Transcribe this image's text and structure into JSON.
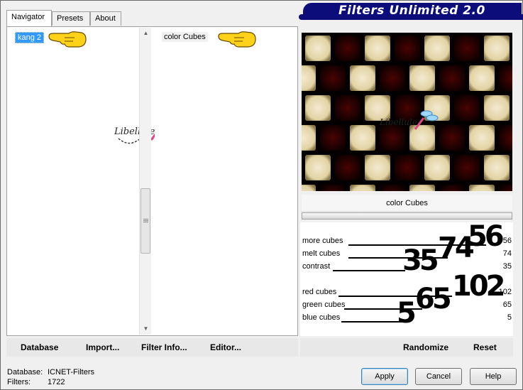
{
  "window": {
    "title": "Filters Unlimited 2.0"
  },
  "tabs": [
    {
      "label": "Navigator",
      "active": true
    },
    {
      "label": "Presets",
      "active": false
    },
    {
      "label": "About",
      "active": false
    }
  ],
  "navigator": {
    "category_selected": "kang 2",
    "filter_selected": "color Cubes"
  },
  "left_buttons": {
    "database": "Database",
    "import": "Import...",
    "filter_info": "Filter Info...",
    "editor": "Editor..."
  },
  "preview": {
    "filter_name": "color Cubes",
    "watermark_text": "Libellule"
  },
  "params": [
    {
      "label": "more cubes",
      "value": "56",
      "overlay": "56"
    },
    {
      "label": "melt cubes",
      "value": "74",
      "overlay": "74"
    },
    {
      "label": "contrast",
      "value": "35",
      "overlay": "35"
    },
    {
      "label": "red cubes",
      "value": "102",
      "overlay": "102"
    },
    {
      "label": "green cubes",
      "value": "65",
      "overlay": "65"
    },
    {
      "label": "blue cubes",
      "value": "5",
      "overlay": "5"
    }
  ],
  "right_buttons": {
    "randomize": "Randomize",
    "reset": "Reset"
  },
  "status": {
    "database_label": "Database:",
    "database_value": "ICNET-Filters",
    "filters_label": "Filters:",
    "filters_value": "1722"
  },
  "dialog_buttons": {
    "apply": "Apply",
    "cancel": "Cancel",
    "help": "Help"
  },
  "colors": {
    "header_bg": "#0c0c7a",
    "selection": "#3399ff",
    "cube_light": "#e8dcb0",
    "cube_dark": "#3a0000"
  },
  "icons": {
    "pointer": "pointing-hand-icon",
    "scroll_up": "scroll-up-icon",
    "scroll_down": "scroll-down-icon"
  }
}
